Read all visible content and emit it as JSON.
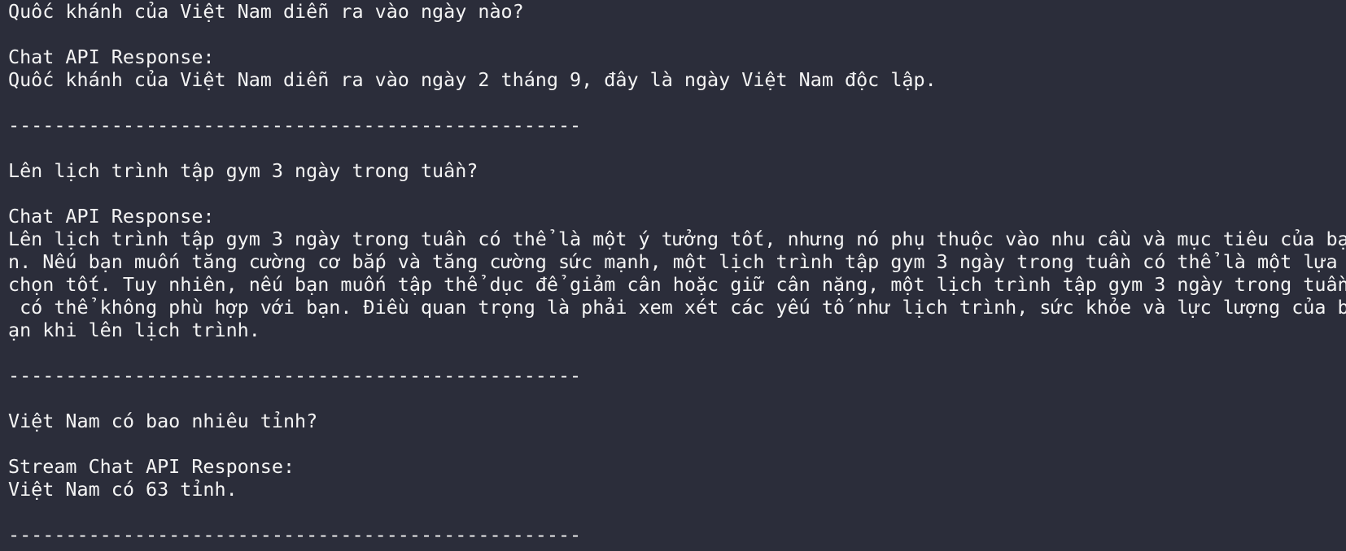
{
  "terminal": {
    "lines": [
      "Quốc khánh của Việt Nam diễn ra vào ngày nào?",
      "",
      "Chat API Response:",
      "Quốc khánh của Việt Nam diễn ra vào ngày 2 tháng 9, đây là ngày Việt Nam độc lập.",
      "",
      "--------------------------------------------------",
      "",
      "Lên lịch trình tập gym 3 ngày trong tuần?",
      "",
      "Chat API Response:",
      "Lên lịch trình tập gym 3 ngày trong tuần có thể là một ý tưởng tốt, nhưng nó phụ thuộc vào nhu cầu và mục tiêu của bạ",
      "n. Nếu bạn muốn tăng cường cơ bắp và tăng cường sức mạnh, một lịch trình tập gym 3 ngày trong tuần có thể là một lựa ",
      "chọn tốt. Tuy nhiên, nếu bạn muốn tập thể dục để giảm cân hoặc giữ cân nặng, một lịch trình tập gym 3 ngày trong tuần",
      " có thể không phù hợp với bạn. Điều quan trọng là phải xem xét các yếu tố như lịch trình, sức khỏe và lực lượng của b",
      "ạn khi lên lịch trình.",
      "",
      "--------------------------------------------------",
      "",
      "Việt Nam có bao nhiêu tỉnh?",
      "",
      "Stream Chat API Response:",
      "Việt Nam có 63 tỉnh.",
      "",
      "--------------------------------------------------"
    ]
  },
  "colors": {
    "background": "#2b2d3a",
    "foreground": "#f4f4f4"
  }
}
